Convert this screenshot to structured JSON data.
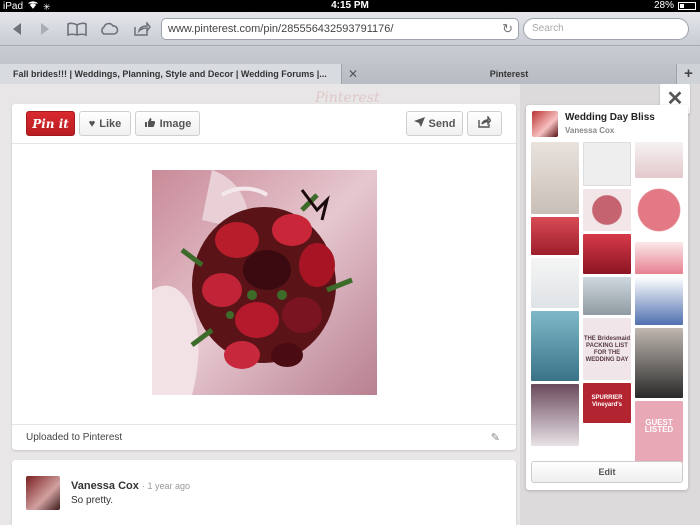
{
  "status_bar": {
    "device": "iPad",
    "time": "4:15 PM",
    "battery": "28%",
    "battery_level": 0.28
  },
  "toolbar": {
    "url": "www.pinterest.com/pin/285556432593791176/",
    "search_placeholder": "Search"
  },
  "tabs": [
    {
      "label": "Fall brides!!! | Weddings, Planning, Style and Decor | Wedding Forums |...",
      "active": true
    },
    {
      "label": "Pinterest",
      "active": false
    }
  ],
  "page": {
    "bg_logo": "Pinterest"
  },
  "pin": {
    "actions": {
      "pin_it": "Pin it",
      "like": "Like",
      "image": "Image",
      "send": "Send"
    },
    "footer_text": "Uploaded to Pinterest"
  },
  "comment": {
    "author": "Vanessa Cox",
    "time": "1 year ago",
    "text": "So pretty."
  },
  "board": {
    "title": "Wedding Day Bliss",
    "owner": "Vanessa Cox",
    "edit_label": "Edit",
    "thumb_texts": {
      "packing_list": "THE Bridesmaid PACKING LIST FOR THE WEDDING DAY",
      "guest_listed": "GUEST LISTED",
      "spurrier": "SPURRIER Vineyard's"
    }
  },
  "colors": {
    "pinit_red": "#c8232c",
    "accent_dark": "#222222"
  }
}
